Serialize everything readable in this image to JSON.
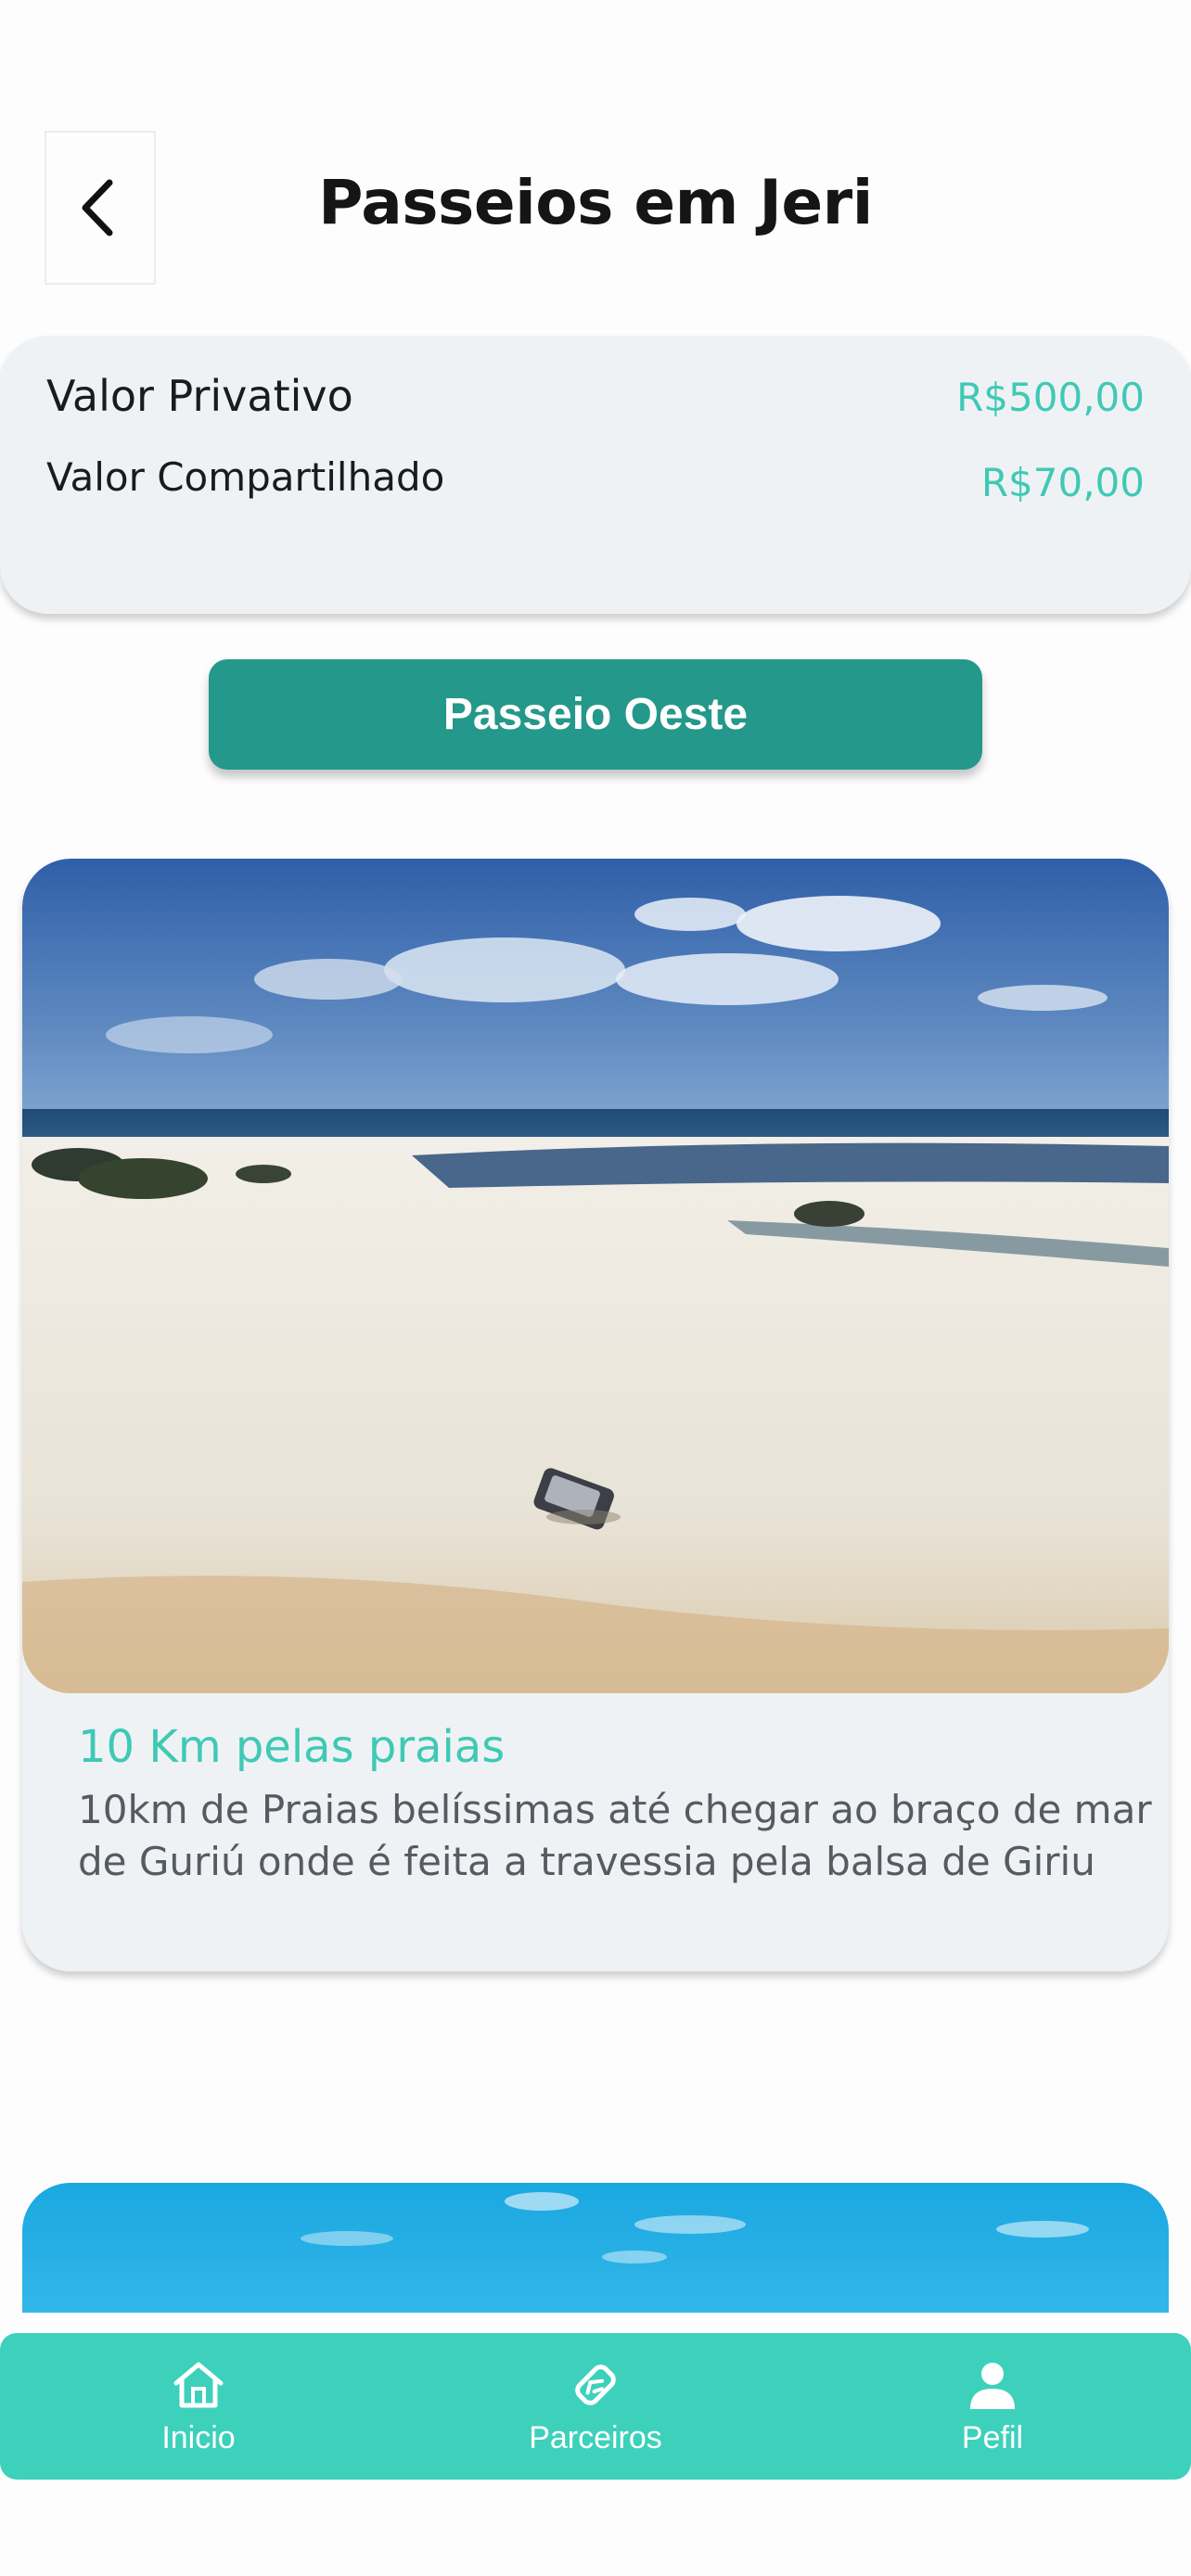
{
  "header": {
    "title": "Passeios em Jeri",
    "back_icon": "chevron-left-icon"
  },
  "prices": {
    "private_label": "Valor Privativo",
    "private_value": "R$500,00",
    "shared_label": "Valor Compartilhado",
    "shared_value": "R$70,00"
  },
  "tour_button": {
    "label": "Passeio Oeste"
  },
  "tours": [
    {
      "title": "10 Km pelas praias",
      "description": "10km de Praias belíssimas até chegar ao braço de mar de Guriú onde é feita a travessia pela balsa de Giriu"
    }
  ],
  "bottom_nav": {
    "items": [
      {
        "label": "Inicio",
        "icon": "home-icon"
      },
      {
        "label": "Parceiros",
        "icon": "handshake-icon"
      },
      {
        "label": "Pefil",
        "icon": "person-icon"
      }
    ]
  },
  "colors": {
    "accent": "#3dd1bc",
    "button": "#24988a",
    "price": "#3fc9b5",
    "card": "#eff2f5"
  }
}
